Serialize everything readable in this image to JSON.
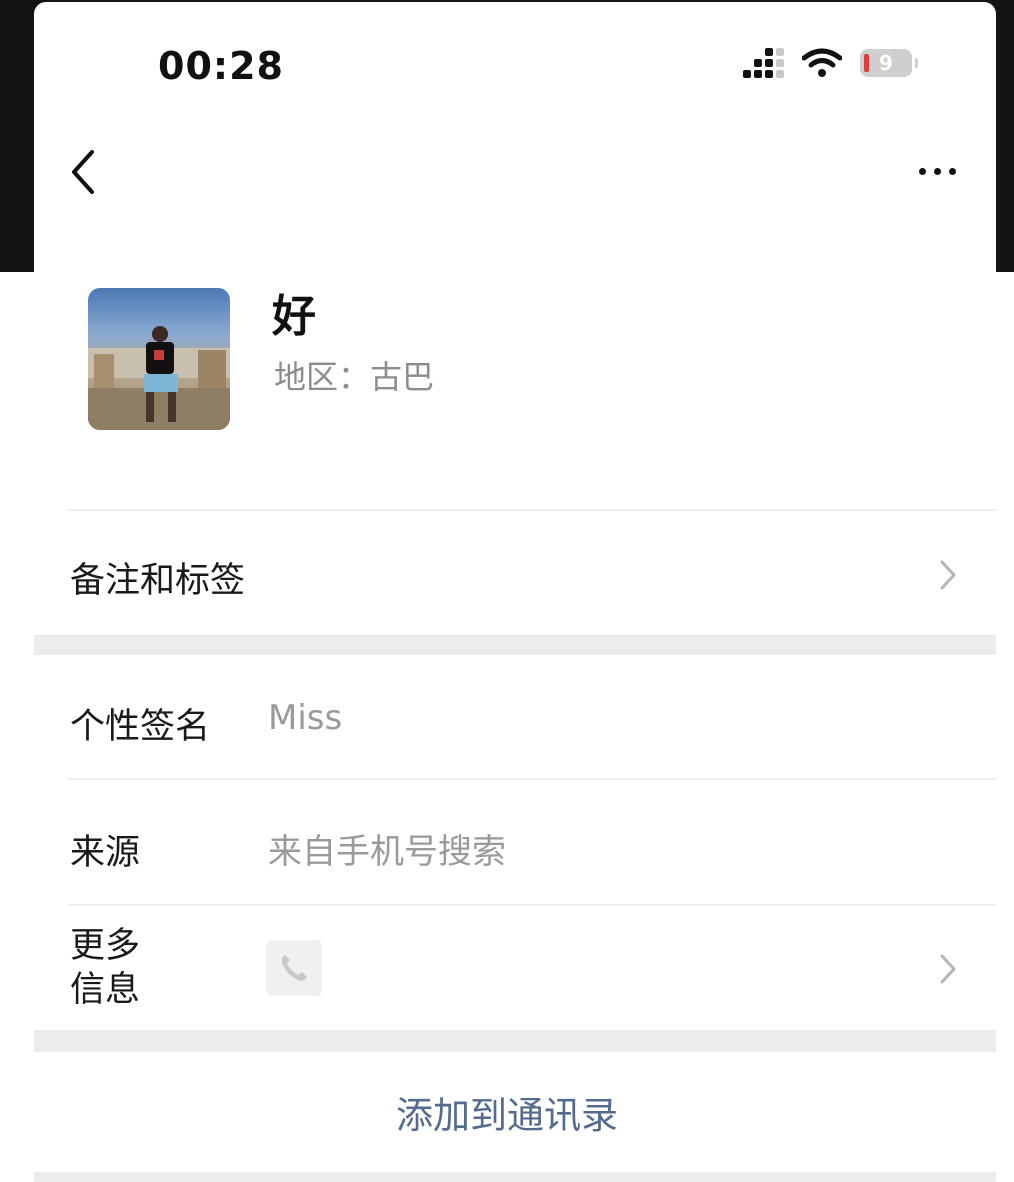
{
  "status_bar": {
    "time": "00:28",
    "battery_level": "9"
  },
  "nav": {
    "back_icon": "chevron-left-icon",
    "more_icon": "more-horizontal-icon"
  },
  "profile": {
    "name": "好",
    "region": "地区：古巴",
    "avatar_icon": "profile-photo"
  },
  "rows": {
    "remarks_tags": {
      "label": "备注和标签"
    },
    "signature": {
      "label": "个性签名",
      "value": "Miss"
    },
    "source": {
      "label": "来源",
      "value": "来自手机号搜索"
    },
    "more_info": {
      "label_line1": "更多",
      "label_line2": "信息",
      "icon": "phone-icon"
    }
  },
  "actions": {
    "add_to_contacts": "添加到通讯录"
  },
  "colors": {
    "link_blue": "#556a8f",
    "battery_low_red": "#e23b3b",
    "secondary_text": "#8c8c8c",
    "section_gap": "#ececec"
  }
}
